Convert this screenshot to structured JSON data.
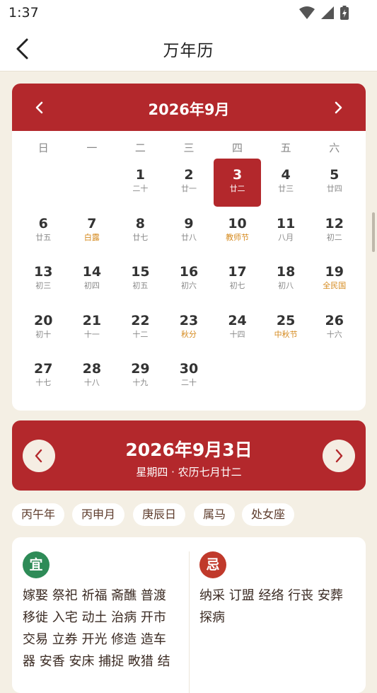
{
  "status": {
    "time": "1:37"
  },
  "header": {
    "title": "万年历"
  },
  "calendar": {
    "month_title": "2026年9月",
    "weekdays": [
      "日",
      "一",
      "二",
      "三",
      "四",
      "五",
      "六"
    ],
    "days": [
      {
        "day": "1",
        "sub": "二十",
        "fest": false
      },
      {
        "day": "2",
        "sub": "廿一",
        "fest": false
      },
      {
        "day": "3",
        "sub": "廿二",
        "fest": false
      },
      {
        "day": "4",
        "sub": "廿三",
        "fest": false
      },
      {
        "day": "5",
        "sub": "廿四",
        "fest": false
      },
      {
        "day": "6",
        "sub": "廿五",
        "fest": false
      },
      {
        "day": "7",
        "sub": "白露",
        "fest": true
      },
      {
        "day": "8",
        "sub": "廿七",
        "fest": false
      },
      {
        "day": "9",
        "sub": "廿八",
        "fest": false
      },
      {
        "day": "10",
        "sub": "教师节",
        "fest": true
      },
      {
        "day": "11",
        "sub": "八月",
        "fest": false
      },
      {
        "day": "12",
        "sub": "初二",
        "fest": false
      },
      {
        "day": "13",
        "sub": "初三",
        "fest": false
      },
      {
        "day": "14",
        "sub": "初四",
        "fest": false
      },
      {
        "day": "15",
        "sub": "初五",
        "fest": false
      },
      {
        "day": "16",
        "sub": "初六",
        "fest": false
      },
      {
        "day": "17",
        "sub": "初七",
        "fest": false
      },
      {
        "day": "18",
        "sub": "初八",
        "fest": false
      },
      {
        "day": "19",
        "sub": "全民国",
        "fest": true
      },
      {
        "day": "20",
        "sub": "初十",
        "fest": false
      },
      {
        "day": "21",
        "sub": "十一",
        "fest": false
      },
      {
        "day": "22",
        "sub": "十二",
        "fest": false
      },
      {
        "day": "23",
        "sub": "秋分",
        "fest": true
      },
      {
        "day": "24",
        "sub": "十四",
        "fest": false
      },
      {
        "day": "25",
        "sub": "中秋节",
        "fest": true
      },
      {
        "day": "26",
        "sub": "十六",
        "fest": false
      },
      {
        "day": "27",
        "sub": "十七",
        "fest": false
      },
      {
        "day": "28",
        "sub": "十八",
        "fest": false
      },
      {
        "day": "29",
        "sub": "十九",
        "fest": false
      },
      {
        "day": "30",
        "sub": "二十",
        "fest": false
      }
    ],
    "first_weekday": 2,
    "selected_day": "3"
  },
  "selected": {
    "date": "2026年9月3日",
    "detail": "星期四 · 农历七月廿二"
  },
  "tags": [
    "丙午年",
    "丙申月",
    "庚辰日",
    "属马",
    "处女座"
  ],
  "almanac": {
    "yi_label": "宜",
    "ji_label": "忌",
    "yi_lines": [
      "嫁娶 祭祀 祈福 斋醮 普渡",
      "移徙 入宅 动土 治病 开市",
      "交易 立券 开光 修造 造车",
      "器 安香 安床 捕捉 畋猎 结"
    ],
    "ji_lines": [
      "纳采 订盟 经络 行丧 安葬",
      "探病"
    ]
  },
  "colors": {
    "primary_red": "#b3282c",
    "festival_orange": "#d58a1e",
    "yi_green": "#2e8b57",
    "ji_red": "#c0392b",
    "background": "#f4efe4"
  },
  "icons": {
    "back": "chevron-left-icon",
    "prev_month": "chevron-left-icon",
    "next_month": "chevron-right-icon",
    "wifi": "wifi-icon",
    "signal": "signal-icon",
    "battery": "battery-charging-icon"
  }
}
